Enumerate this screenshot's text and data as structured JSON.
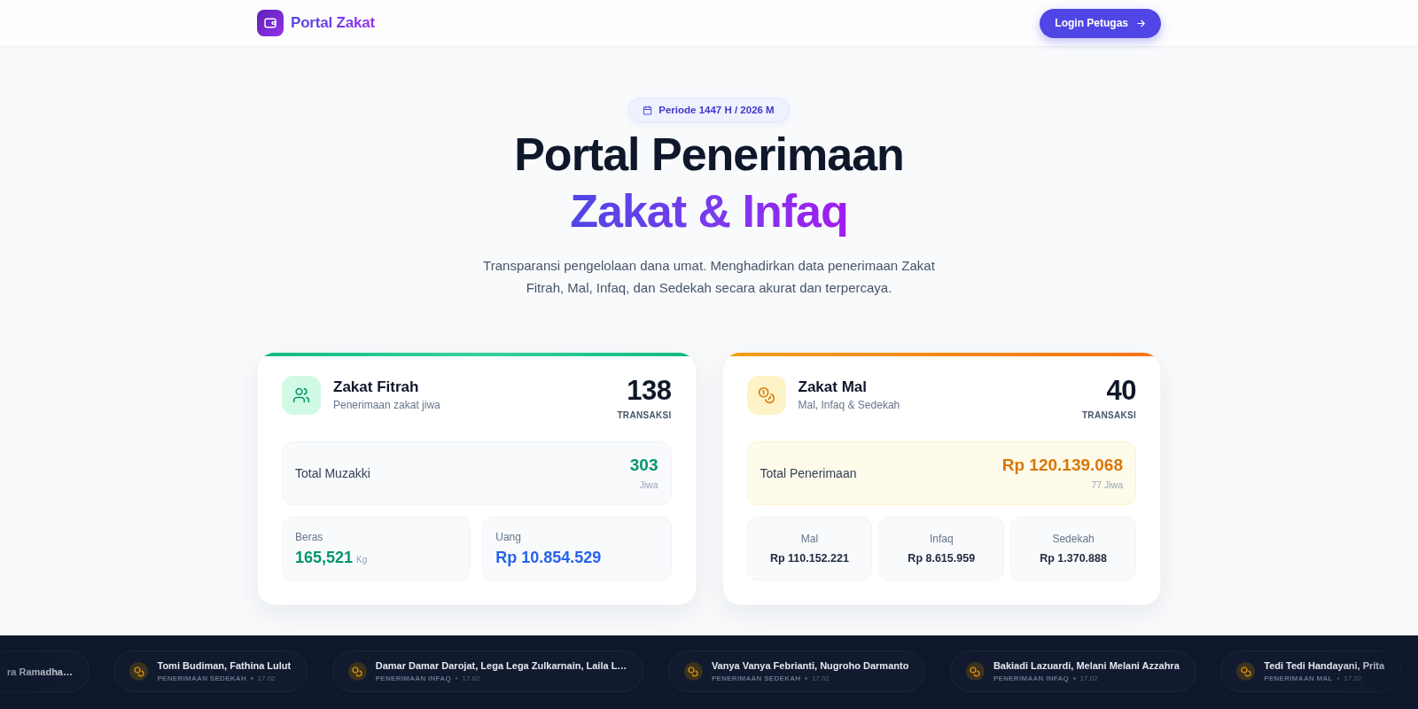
{
  "header": {
    "brand": "Portal Zakat",
    "login_button": "Login Petugas"
  },
  "hero": {
    "period_badge": "Periode 1447 H / 2026 M",
    "title_line_1": "Portal Penerimaan",
    "title_line_2": "Zakat & Infaq",
    "description": "Transparansi pengelolaan dana umat. Menghadirkan data penerimaan Zakat Fitrah, Mal, Infaq, dan Sedekah secara akurat dan terpercaya."
  },
  "cards": [
    {
      "kind": "fitrah",
      "title": "Zakat Fitrah",
      "subtitle": "Penerimaan zakat jiwa",
      "count": "138",
      "count_label": "TRANSAKSI",
      "total": {
        "label": "Total Muzakki",
        "value": "303",
        "note": "Jiwa"
      },
      "breakdown": [
        {
          "label": "Beras",
          "value": "165,521",
          "unit": "Kg",
          "color": "#059669"
        },
        {
          "label": "Uang",
          "value": "Rp 10.854.529",
          "color": "#2563eb"
        }
      ]
    },
    {
      "kind": "mal",
      "title": "Zakat Mal",
      "subtitle": "Mal, Infaq & Sedekah",
      "count": "40",
      "count_label": "TRANSAKSI",
      "total": {
        "label": "Total Penerimaan",
        "value": "Rp 120.139.068",
        "note": "77 Jiwa"
      },
      "breakdown": [
        {
          "label": "Mal",
          "value": "Rp 110.152.221"
        },
        {
          "label": "Infaq",
          "value": "Rp 8.615.959"
        },
        {
          "label": "Sedekah",
          "value": "Rp 1.370.888"
        }
      ]
    }
  ],
  "ticker": [
    {
      "name": "ra Ramadha…"
    },
    {
      "name": "Tomi Budiman, Fathina Lulut",
      "category": "PENERIMAAN SEDEKAH",
      "time": "17.02"
    },
    {
      "name": "Damar Damar Darojat, Lega Lega Zulkarnain, Laila L…",
      "category": "PENERIMAAN INFAQ",
      "time": "17.02"
    },
    {
      "name": "Vanya Vanya Febrianti, Nugroho Darmanto",
      "category": "PENERIMAAN SEDEKAH",
      "time": "17.02"
    },
    {
      "name": "Bakiadi Lazuardi, Melani Melani Azzahra",
      "category": "PENERIMAAN INFAQ",
      "time": "17.02"
    },
    {
      "name": "Tedi Tedi Handayani, Prita",
      "category": "PENERIMAAN MAL",
      "time": "17.02"
    }
  ]
}
